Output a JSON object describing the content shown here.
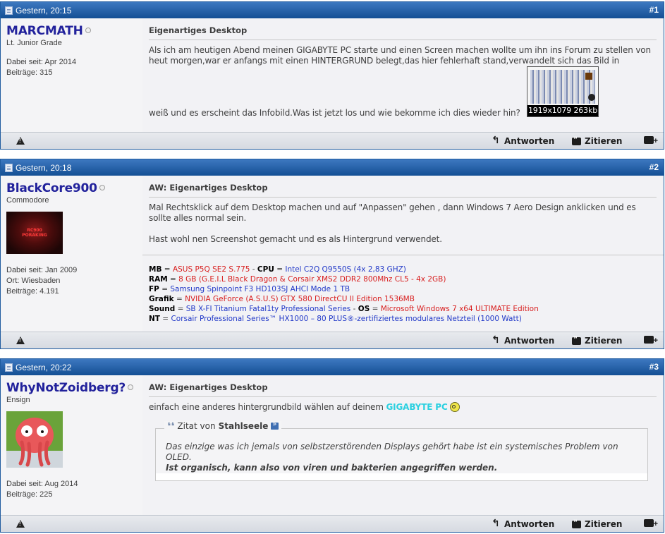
{
  "posts": [
    {
      "date": "Gestern, 20:15",
      "num": "#1",
      "username": "MARCMATH",
      "usertitle": "Lt. Junior Grade",
      "joined": "Dabei seit: Apr 2014",
      "posts_count": "Beiträge: 315",
      "title": "Eigenartiges Desktop",
      "text_1": "Als ich am heutigen Abend meinen GIGABYTE PC starte und einen Screen machen wollte um ihn ins Forum zu stellen von heut morgen,war er anfangs mit einen HINTERGRUND belegt,das hier fehlerhaft stand,verwandelt sich das Bild in",
      "text_2": "weiß und es erscheint das Infobild.Was ist jetzt los und wie bekomme ich dies wieder hin?",
      "thumb_caption": "1919x1079 263kb"
    },
    {
      "date": "Gestern, 20:18",
      "num": "#2",
      "username": "BlackCore900",
      "usertitle": "Commodore",
      "avatar_text_1": "RC900",
      "avatar_text_2": "PORAKING",
      "joined": "Dabei seit: Jan 2009",
      "location": "Ort: Wiesbaden",
      "posts_count": "Beiträge: 4.191",
      "title": "AW: Eigenartiges Desktop",
      "text_1": "Mal Rechtsklick auf dem Desktop machen und auf \"Anpassen\" gehen , dann Windows 7 Aero Design anklicken und es sollte alles normal sein.",
      "text_2": "Hast wohl nen Screenshot gemacht und es als Hintergrund verwendet.",
      "sig": {
        "mb_label": "MB",
        "mb": "ASUS P5Q SE2 S.775",
        "cpu_label": "CPU",
        "cpu": "Intel C2Q Q9550S (4x 2,83 GHZ)",
        "ram_label": "RAM",
        "ram": "8 GB (G.E.I.L Black Dragon & Corsair XMS2 DDR2 800Mhz CL5 - 4x 2GB)",
        "fp_label": "FP",
        "fp": "Samsung Spinpoint F3 HD103SJ AHCI Mode 1 TB",
        "grafik_label": "Grafik",
        "grafik": "NVIDIA GeForce (A.S.U.S) GTX 580 DirectCU II Edition 1536MB",
        "sound_label": "Sound",
        "sound": "SB X-FI Titanium Fatal1ty Professional Series",
        "os_label": "OS",
        "os": "Microsoft Windows 7 x64 ULTIMATE Edition",
        "nt_label": "NT",
        "nt": "Corsair Professional Series™ HX1000 – 80 PLUS®-zertifiziertes modulares Netzteil (1000 Watt)"
      }
    },
    {
      "date": "Gestern, 20:22",
      "num": "#3",
      "username": "WhyNotZoidberg?",
      "usertitle": "Ensign",
      "joined": "Dabei seit: Aug 2014",
      "posts_count": "Beiträge: 225",
      "title": "AW: Eigenartiges Desktop",
      "text_1": "einfach eine anderes hintergrundbild wählen auf deinem",
      "highlight": "GIGABYTE PC",
      "quote_prefix": "Zitat von",
      "quote_author": "Stahlseele",
      "quote_line_1": "Das einzige was ich jemals von selbstzerstörenden Displays gehört habe ist ein systemisches Problem von OLED.",
      "quote_line_2": "Ist organisch, kann also von viren und bakterien angegriffen werden."
    }
  ],
  "footer": {
    "reply_label": "Antworten",
    "quote_label": "Zitieren"
  },
  "colors": {
    "header_top": "#3d78c0",
    "header_bottom": "#144f94",
    "username": "#22229c",
    "sig_red": "#d81e1e",
    "sig_blue": "#2239c8",
    "highlight": "#2ad0e0"
  },
  "icons": [
    "post-doc-icon",
    "online-status-icon",
    "report-icon",
    "reply-icon",
    "quote-icon",
    "multiquote-icon",
    "quote-mark-icon",
    "goto-post-icon",
    "smiley-icon"
  ]
}
